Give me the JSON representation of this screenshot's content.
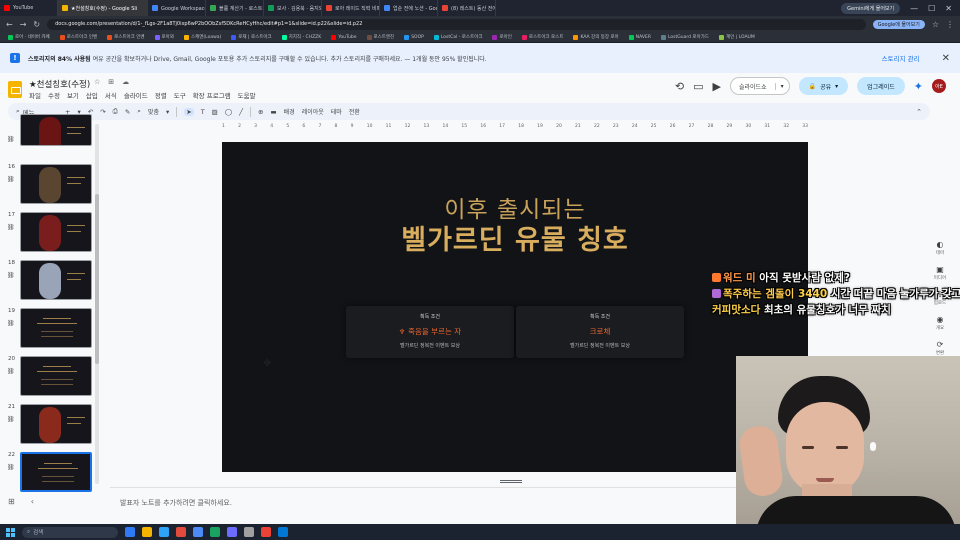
{
  "browser": {
    "tabs": [
      {
        "title": "YouTube",
        "color": "#ff0000",
        "active": false
      },
      {
        "title": "★천설칭호(수정) - Google Sli",
        "color": "#f4b400",
        "active": true
      },
      {
        "title": "Google Workspace에 가입하기",
        "color": "#4285f4",
        "active": false
      },
      {
        "title": "볼륨 계산기 - 로스트갤러",
        "color": "#34a853",
        "active": false
      },
      {
        "title": "보사 · 김용북 · 음지와 노딩아",
        "color": "#0f9d58",
        "active": false
      },
      {
        "title": "로아 레이드 직력 비폐데이터",
        "color": "#ea4335",
        "active": false
      },
      {
        "title": "업순 전에 노션 - Google 검색",
        "color": "#4285f4",
        "active": false
      },
      {
        "title": "(8) 레스트) 동산 전에 노션 합",
        "color": "#ea4335",
        "active": false
      }
    ],
    "gemini_chip": "Gemini에게 물어보기",
    "url": "docs.google.com/presentation/d/1-_fLgs-2F1a8Tj0ixp6wP2bOObZsf5DKcReHCyHhc/edit#p1=1&slide=id.p22&slide=id.p22",
    "promo_button": "Google에 물어보기",
    "bookmarks": [
      {
        "label": "로아 · 네이버 카페",
        "color": "#03c75a"
      },
      {
        "label": "로스트아크 인벤",
        "color": "#e94e1b"
      },
      {
        "label": "로스트아크 인벤",
        "color": "#e94e1b"
      },
      {
        "label": "로아와",
        "color": "#7b61ff"
      },
      {
        "label": "스캐엔(Loawa)",
        "color": "#ffb400"
      },
      {
        "label": "로재 | 로스트아크",
        "color": "#3d5afe"
      },
      {
        "label": "치지직 - CHZZK",
        "color": "#00ffa3"
      },
      {
        "label": "YouTube",
        "color": "#ff0000"
      },
      {
        "label": "로스트엔진",
        "color": "#6d4c41"
      },
      {
        "label": "SOOP",
        "color": "#2196f3"
      },
      {
        "label": "LostCal - 로스트아크",
        "color": "#00bcd4"
      },
      {
        "label": "로아인",
        "color": "#9c27b0"
      },
      {
        "label": "로스트아크 로스트",
        "color": "#e91e63"
      },
      {
        "label": "KAA 강의 등장 로아",
        "color": "#ff9800"
      },
      {
        "label": "NAVER",
        "color": "#03c75a"
      },
      {
        "label": "LostGuard 로아가드",
        "color": "#607d8b"
      },
      {
        "label": "계인 | LOAUM",
        "color": "#8bc34a"
      }
    ]
  },
  "storage_banner": {
    "bold": "스토리지의 84% 사용됨",
    "message": "여유 공간을 확보하거나 Drive, Gmail, Google 포토용 추가 스토리지를 구매할 수 있습니다. 추가 스토리지를 구매하세요. — 1개월 동안 95% 할인됩니다.",
    "manage": "스토리지 관리"
  },
  "app": {
    "doc_title": "★천설칭호(수정)",
    "menus": [
      "파일",
      "수정",
      "보기",
      "삽입",
      "서식",
      "슬라이드",
      "정렬",
      "도구",
      "확장 프로그램",
      "도움말"
    ],
    "slideshow_label": "슬라이드쇼",
    "share_label": "공유",
    "upgrade_label": "업그레이드",
    "avatar_initials": "아E"
  },
  "toolbar": {
    "search_label": "메뉴",
    "zoom": "맞춤",
    "background": "배경",
    "layout": "레이아웃",
    "theme": "테마",
    "transition": "전환"
  },
  "ruler": [
    "1",
    "2",
    "3",
    "4",
    "5",
    "6",
    "7",
    "8",
    "9",
    "10",
    "11",
    "12",
    "13",
    "14",
    "15",
    "16",
    "17",
    "18",
    "19",
    "20",
    "21",
    "22",
    "23",
    "24",
    "25",
    "26",
    "27",
    "28",
    "29",
    "30",
    "31",
    "32",
    "33"
  ],
  "filmstrip": [
    {
      "num": "",
      "kind": "art",
      "art_color": "#6b1414"
    },
    {
      "num": "16",
      "kind": "art",
      "art_color": "#5a4630"
    },
    {
      "num": "17",
      "kind": "art",
      "art_color": "#7a1d1d"
    },
    {
      "num": "18",
      "kind": "art",
      "art_color": "#9aa4b8"
    },
    {
      "num": "19",
      "kind": "text",
      "art_color": "#15151b"
    },
    {
      "num": "20",
      "kind": "text",
      "art_color": "#15151b"
    },
    {
      "num": "21",
      "kind": "art",
      "art_color": "#8a2a1c"
    },
    {
      "num": "22",
      "kind": "text",
      "art_color": "#15151b",
      "selected": true
    }
  ],
  "slide": {
    "subtitle": "이후 출시되는",
    "title": "벨가르딘 유물 칭호",
    "cards": [
      {
        "header": "획득 조건",
        "name": "죽음을 부르는 자",
        "desc": "벨가르딘 정복전 이벤트 보상",
        "crest": true
      },
      {
        "header": "획득 조건",
        "name": "크로체",
        "desc": "벨가르딘 정복전 이벤트 보상",
        "crest": false
      }
    ]
  },
  "notes_placeholder": "발표자 노트를 추가하려면 클릭하세요.",
  "side_panel": [
    "테마",
    "미디어",
    "업로드",
    "개요",
    "변환"
  ],
  "chat": [
    {
      "badge_color": "#ff7a2f",
      "nick": "워드 미",
      "msg": "아직 못받사람 없제?"
    },
    {
      "badge_color": "#b06ad6",
      "nick": "폭주하는 겜돌이",
      "num": "3440",
      "msg": "시간 떠끝 마음 눌가루가 갖고있는거"
    },
    {
      "badge_color": "",
      "nick": "커피맛소다",
      "msg": "최초의 유물칭호가 너무 짜치"
    }
  ],
  "taskbar": {
    "search_placeholder": "검색",
    "apps": [
      "#2f7bf5",
      "#f4b400",
      "#2fa3f5",
      "#e24a3b",
      "#4c8bf5",
      "#1aa260",
      "#6c6cff",
      "#a0a0a0",
      "#ea4335",
      "#0078d4"
    ]
  }
}
